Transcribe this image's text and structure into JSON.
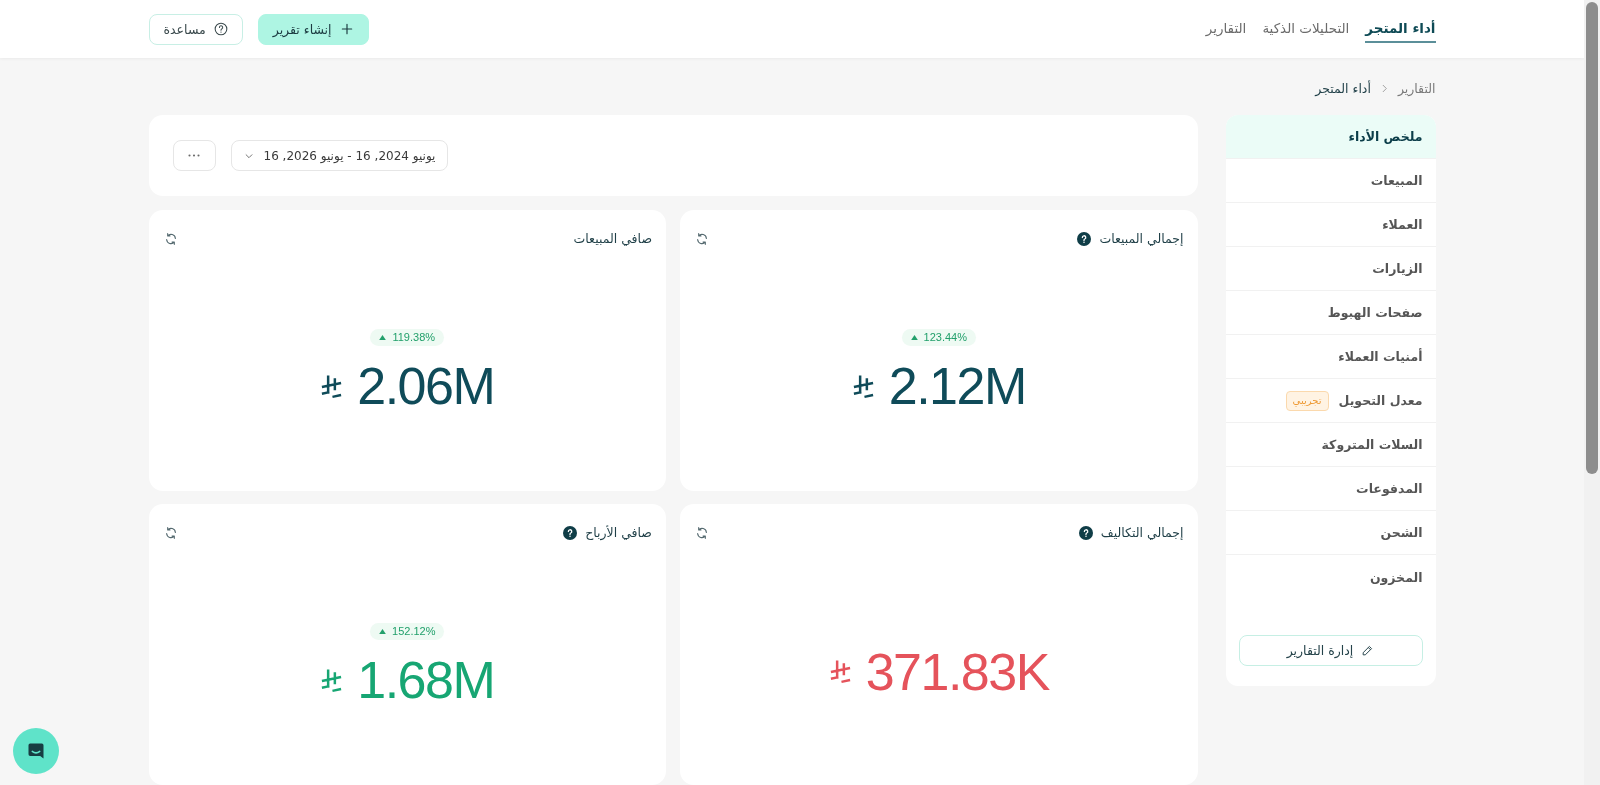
{
  "top_nav": {
    "tabs": [
      {
        "label": "أداء المتجر",
        "selected": true
      },
      {
        "label": "التحليلات الذكية",
        "selected": false
      },
      {
        "label": "التقارير",
        "selected": false
      }
    ],
    "actions": [
      {
        "kind": "primary",
        "label": "إنشاء تقرير"
      },
      {
        "kind": "secondary",
        "label": "مساعدة"
      }
    ]
  },
  "breadcrumb": [
    {
      "label": "التقارير",
      "current": false
    },
    {
      "label": "أداء المتجر",
      "current": true
    }
  ],
  "sidebar": {
    "items": [
      {
        "label": "ملخص الأداء",
        "selected": true
      },
      {
        "label": "المبيعات",
        "selected": false
      },
      {
        "label": "العملاء",
        "selected": false
      },
      {
        "label": "الزيارات",
        "selected": false
      },
      {
        "label": "صفحات الهبوط",
        "selected": false
      },
      {
        "label": "أمنيات العملاء",
        "selected": false
      },
      {
        "label": "معدل التحويل",
        "selected": false,
        "badge": "تجريبي"
      },
      {
        "label": "السلات المتروكة",
        "selected": false
      },
      {
        "label": "المدفوعات",
        "selected": false
      },
      {
        "label": "الشحن",
        "selected": false
      },
      {
        "label": "المخزون",
        "selected": false
      }
    ],
    "manage_button": "إدارة التقارير"
  },
  "filters": {
    "date_range": "يونيو 2024, 16 - يونيو 2026, 16"
  },
  "metrics": [
    {
      "title": "إجمالي المبيعات",
      "help": true,
      "change": "123.44%",
      "rising": true,
      "value": "2.12M",
      "color": "#0f4b59"
    },
    {
      "title": "صافي المبيعات",
      "help": false,
      "change": "119.38%",
      "rising": true,
      "value": "2.06M",
      "color": "#0f4b59"
    },
    {
      "title": "إجمالي التكاليف",
      "help": true,
      "value": "371.83K",
      "color": "#e5535b"
    },
    {
      "title": "صافي الأرباح",
      "help": true,
      "change": "152.12%",
      "rising": true,
      "value": "1.68M",
      "color": "#17a673"
    }
  ]
}
